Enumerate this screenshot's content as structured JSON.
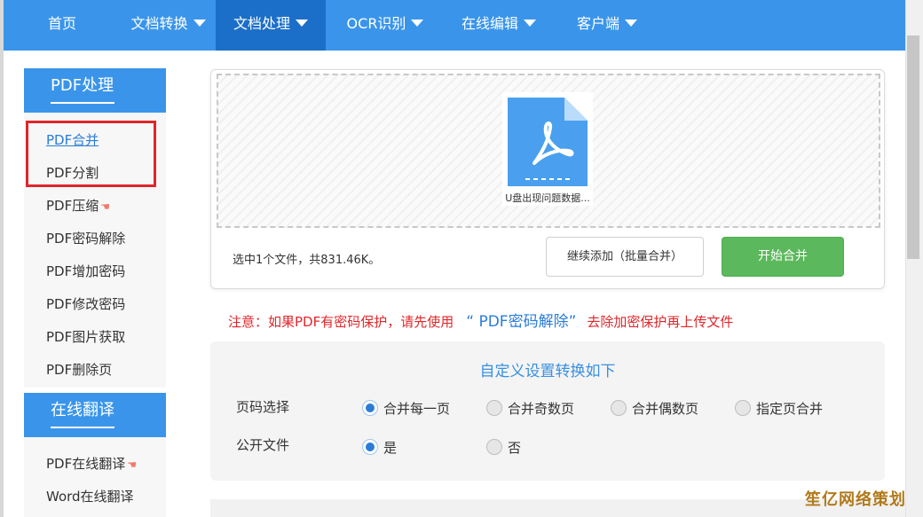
{
  "nav": {
    "items": [
      {
        "label": "首页",
        "dropdown": false,
        "active": false
      },
      {
        "label": "文档转换",
        "dropdown": true,
        "active": false
      },
      {
        "label": "文档处理",
        "dropdown": true,
        "active": true
      },
      {
        "label": "OCR识别",
        "dropdown": true,
        "active": false
      },
      {
        "label": "在线编辑",
        "dropdown": true,
        "active": false
      },
      {
        "label": "客户端",
        "dropdown": true,
        "active": false
      }
    ]
  },
  "sidebar": {
    "pdf_section_title": "PDF处理",
    "pdf_items": [
      {
        "label": "PDF合并",
        "selected": true
      },
      {
        "label": "PDF分割"
      },
      {
        "label": "PDF压缩",
        "icon": "hand-pointer-icon"
      },
      {
        "label": "PDF密码解除"
      },
      {
        "label": "PDF增加密码"
      },
      {
        "label": "PDF修改密码"
      },
      {
        "label": "PDF图片获取"
      },
      {
        "label": "PDF删除页"
      }
    ],
    "translate_section_title": "在线翻译",
    "translate_items": [
      {
        "label": "PDF在线翻译",
        "icon": "hand-pointer-icon"
      },
      {
        "label": "Word在线翻译"
      }
    ]
  },
  "upload": {
    "file_name": "U盘出现问题数据...",
    "file_icon": "pdf-file-icon",
    "summary": "选中1个文件，共831.46K。",
    "add_button": "继续添加（批量合并）",
    "start_button": "开始合并"
  },
  "notice": {
    "before": "注意：如果PDF有密码保护，请先使用",
    "link": "“ PDF密码解除”",
    "after": "去除加密保护再上传文件"
  },
  "settings": {
    "title": "自定义设置转换如下",
    "page_select": {
      "label": "页码选择",
      "options": [
        "合并每一页",
        "合并奇数页",
        "合并偶数页",
        "指定页合并"
      ],
      "selected": "合并每一页"
    },
    "public_file": {
      "label": "公开文件",
      "options": [
        "是",
        "否"
      ],
      "selected": "是"
    }
  },
  "colors": {
    "nav_bg": "#3a95ea",
    "nav_active": "#1c6fc8",
    "start_button": "#5cb85c",
    "notice": "#e0262a",
    "link": "#2a7cd8"
  },
  "watermark": "笙亿网络策划"
}
